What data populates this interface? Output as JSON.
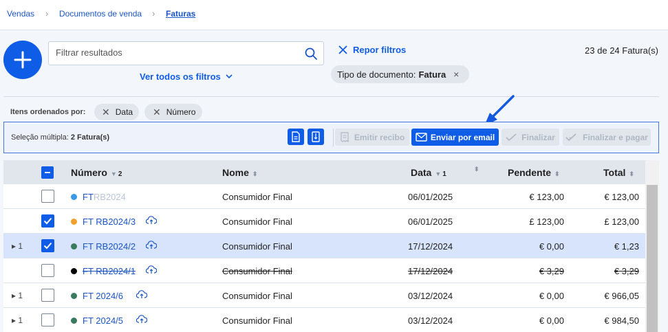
{
  "breadcrumb": [
    "Vendas",
    "Documentos de venda",
    "Faturas"
  ],
  "search": {
    "placeholder": "Filtrar resultados"
  },
  "links": {
    "all_filters": "Ver todos os filtros",
    "reset_filters": "Repor filtros"
  },
  "count_text": "23 de 24 Fatura(s)",
  "filter_chip": {
    "label": "Tipo de documento:",
    "value": "Fatura"
  },
  "sorting": {
    "label": "Itens ordenados por:",
    "chips": [
      "Data",
      "Número"
    ]
  },
  "selection": {
    "label": "Seleção múltipla:",
    "value": "2 Fatura(s)"
  },
  "actions": {
    "emit_receipt": "Emitir recibo",
    "send_email": "Enviar por email",
    "finalize": "Finalizar",
    "finalize_pay": "Finalizar e pagar"
  },
  "columns": {
    "number": "Número",
    "number_sort_order": "2",
    "name": "Nome",
    "date": "Data",
    "date_sort_order": "1",
    "pending": "Pendente",
    "total": "Total"
  },
  "rows": [
    {
      "expand_count": "",
      "checked": false,
      "status_color": "#3b9ae8",
      "number": "FT",
      "number_suffix": "RB2024",
      "cloud": false,
      "name": "Consumidor Final",
      "date": "06/01/2025",
      "pending": "€ 123,00",
      "total": "€ 123,00",
      "selected": false,
      "struck": false
    },
    {
      "expand_count": "",
      "checked": true,
      "status_color": "#f2a12b",
      "number": "FT RB2024/3",
      "number_suffix": "",
      "cloud": true,
      "name": "Consumidor Final",
      "date": "06/01/2025",
      "pending": "£ 123,00",
      "total": "£ 123,00",
      "selected": false,
      "struck": false
    },
    {
      "expand_count": "1",
      "checked": true,
      "status_color": "#3a7a5f",
      "number": "FT RB2024/2",
      "number_suffix": "",
      "cloud": true,
      "name": "Consumidor Final",
      "date": "17/12/2024",
      "pending": "€ 0,00",
      "total": "€ 1,23",
      "selected": true,
      "struck": false
    },
    {
      "expand_count": "",
      "checked": false,
      "status_color": "#000000",
      "number": "FT RB2024/1",
      "number_suffix": "",
      "cloud": true,
      "name": "Consumidor Final",
      "date": "17/12/2024",
      "pending": "€ 3,29",
      "total": "€ 3,29",
      "selected": false,
      "struck": true
    },
    {
      "expand_count": "1",
      "checked": false,
      "status_color": "#3a7a5f",
      "number": "FT 2024/6",
      "number_suffix": "",
      "cloud": true,
      "name": "Consumidor Final",
      "date": "03/12/2024",
      "pending": "€ 0,00",
      "total": "€ 966,05",
      "selected": false,
      "struck": false
    },
    {
      "expand_count": "1",
      "checked": false,
      "status_color": "#3a7a5f",
      "number": "FT 2024/5",
      "number_suffix": "",
      "cloud": true,
      "name": "Consumidor Final",
      "date": "03/12/2024",
      "pending": "€ 0,00",
      "total": "€ 984,50",
      "selected": false,
      "struck": false
    }
  ],
  "colors": {
    "primary": "#0f5ce6",
    "selected_row": "#d7e4fb",
    "link": "#1a56c8"
  }
}
